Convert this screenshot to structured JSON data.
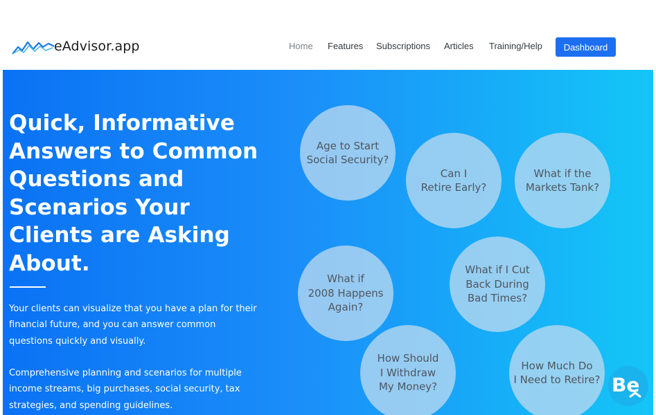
{
  "brand": {
    "name": "eAdvisor.app",
    "logo_icon": "mountain-peaks-icon"
  },
  "nav": {
    "items": [
      {
        "label": "Home",
        "active": true
      },
      {
        "label": "Features",
        "active": false
      },
      {
        "label": "Subscriptions",
        "active": false
      },
      {
        "label": "Articles",
        "active": false
      },
      {
        "label": "Training/Help",
        "active": false
      }
    ],
    "dashboard_label": "Dashboard"
  },
  "hero": {
    "title": "Quick, Informative Answers to Common Questions and Scenarios Your Clients are Asking About.",
    "paragraph1": "Your clients can visualize that you have a plan for their financial future, and you can answer common questions quickly and visually.",
    "paragraph2": "Comprehensive planning and scenarios for multiple income streams, big purchases, social security, tax strategies, and spending guidelines."
  },
  "questions": [
    "Age to Start\nSocial Security?",
    "Can I\nRetire Early?",
    "What if the\nMarkets Tank?",
    "What if\n2008 Happens\nAgain?",
    "What if I Cut\nBack During\nBad Times?",
    "How Should\nI Withdraw\nMy Money?",
    "How Much Do\nI Need to Retire?"
  ],
  "badge": {
    "text": "Be",
    "icon": "behance-style-badge-icon"
  },
  "colors": {
    "accent": "#1d6ff2",
    "hero_start": "#0a72f4",
    "hero_end": "#14c6f7",
    "bubble": "#bad8f0",
    "bubble_text": "#4f5660"
  }
}
